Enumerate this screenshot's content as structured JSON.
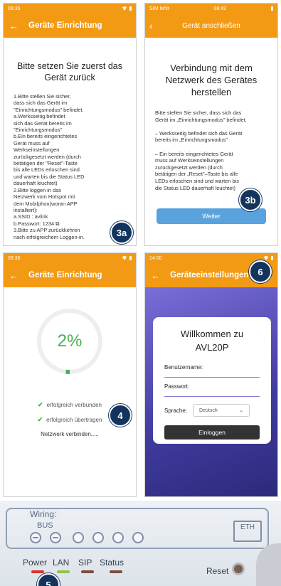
{
  "panels": {
    "p1": {
      "status_time": "09:35",
      "title": "Geräte Einrichtung",
      "heading": "Bitte setzen Sie zuerst das Gerät zurück",
      "instructions": "1.Bitte stellen Sie sicher,\ndass sich das Gerät im\n\"Einrichtungsmodus\" befindet.\na.Werksseitig befindet\nsich das Gerät bereits im\n\"Einrichtungsmodus\"\nb.Ein bereits eingerichtetes\nGerät muss auf\nWerkseinstellungen\nzurückgesetzt werden (durch\nbetätigen der \"Reset\"-Taste\nbis alle LEDs erloschen sind\nund warten bis die Status LED\ndauerhaft leuchtet)\n2.Bitte loggen in das\nNetzwerk vom Hotspot mit\ndem Mobilphon(woran APP\ninstalliert):\n          a.SSID : avlink\n          b.Passwort: 1234 ⧉\n3.Bitte zu APP zurückkehren\nnach erfolgreichem Loggen-in.",
      "badge": "3a"
    },
    "p2": {
      "status_left": "SIM fehlt",
      "status_time": "08:42",
      "title": "Gerät anschließen",
      "heading": "Verbindung mit dem Netzwerk des Gerätes herstellen",
      "instructions": "Bitte stellen Sie sicher, dass sich das\nGerät im „Einrichtungsmodus\" befindet.\n\n   – Werksseitig befindet sich das Gerät\n   bereits im „Einrichtungsmodus\"\n\n   – Ein bereits eingerichtetes Gerät\n   muss auf Werkseinstellungen\n   zurückgesetzt werden (durch\n   betätigen der „Reset\"–Taste bis alle\n   LEDs erloschen sind und warten bis\n   die Status LED dauerhaft leuchtet)",
      "button": "Weiter",
      "badge": "3b"
    },
    "p3": {
      "status_time": "09:36",
      "title": "Geräte Einrichtung",
      "percent_label": "2%",
      "progress": 0.02,
      "status1": "erfolgreich verbunden",
      "status2": "erfolgreich übertragen",
      "status3": "Netzwerk verbinden.....",
      "badge": "4"
    },
    "p4": {
      "status_time": "14:00",
      "title": "Geräteeinstellungen",
      "welcome": "Willkommen zu AVL20P",
      "username_label": "Benutzername:",
      "password_label": "Passwort:",
      "language_label": "Sprache:",
      "language_value": "Deutsch",
      "login_button": "Einloggen",
      "badge": "6"
    }
  },
  "device": {
    "wiring_label": "Wiring:",
    "bus_label": "BUS",
    "eth_label": "ETH",
    "leds": [
      "Power",
      "LAN",
      "SIP",
      "Status"
    ],
    "led_colors": [
      "#d9342b",
      "#8fc34a",
      "#7a4e3c",
      "#7a4e3c"
    ],
    "reset_label": "Reset",
    "badge": "5"
  },
  "colors": {
    "app_orange": "#f39a14",
    "badge_navy": "#14345e",
    "success_green": "#4caf50",
    "button_blue": "#5aa2de"
  }
}
